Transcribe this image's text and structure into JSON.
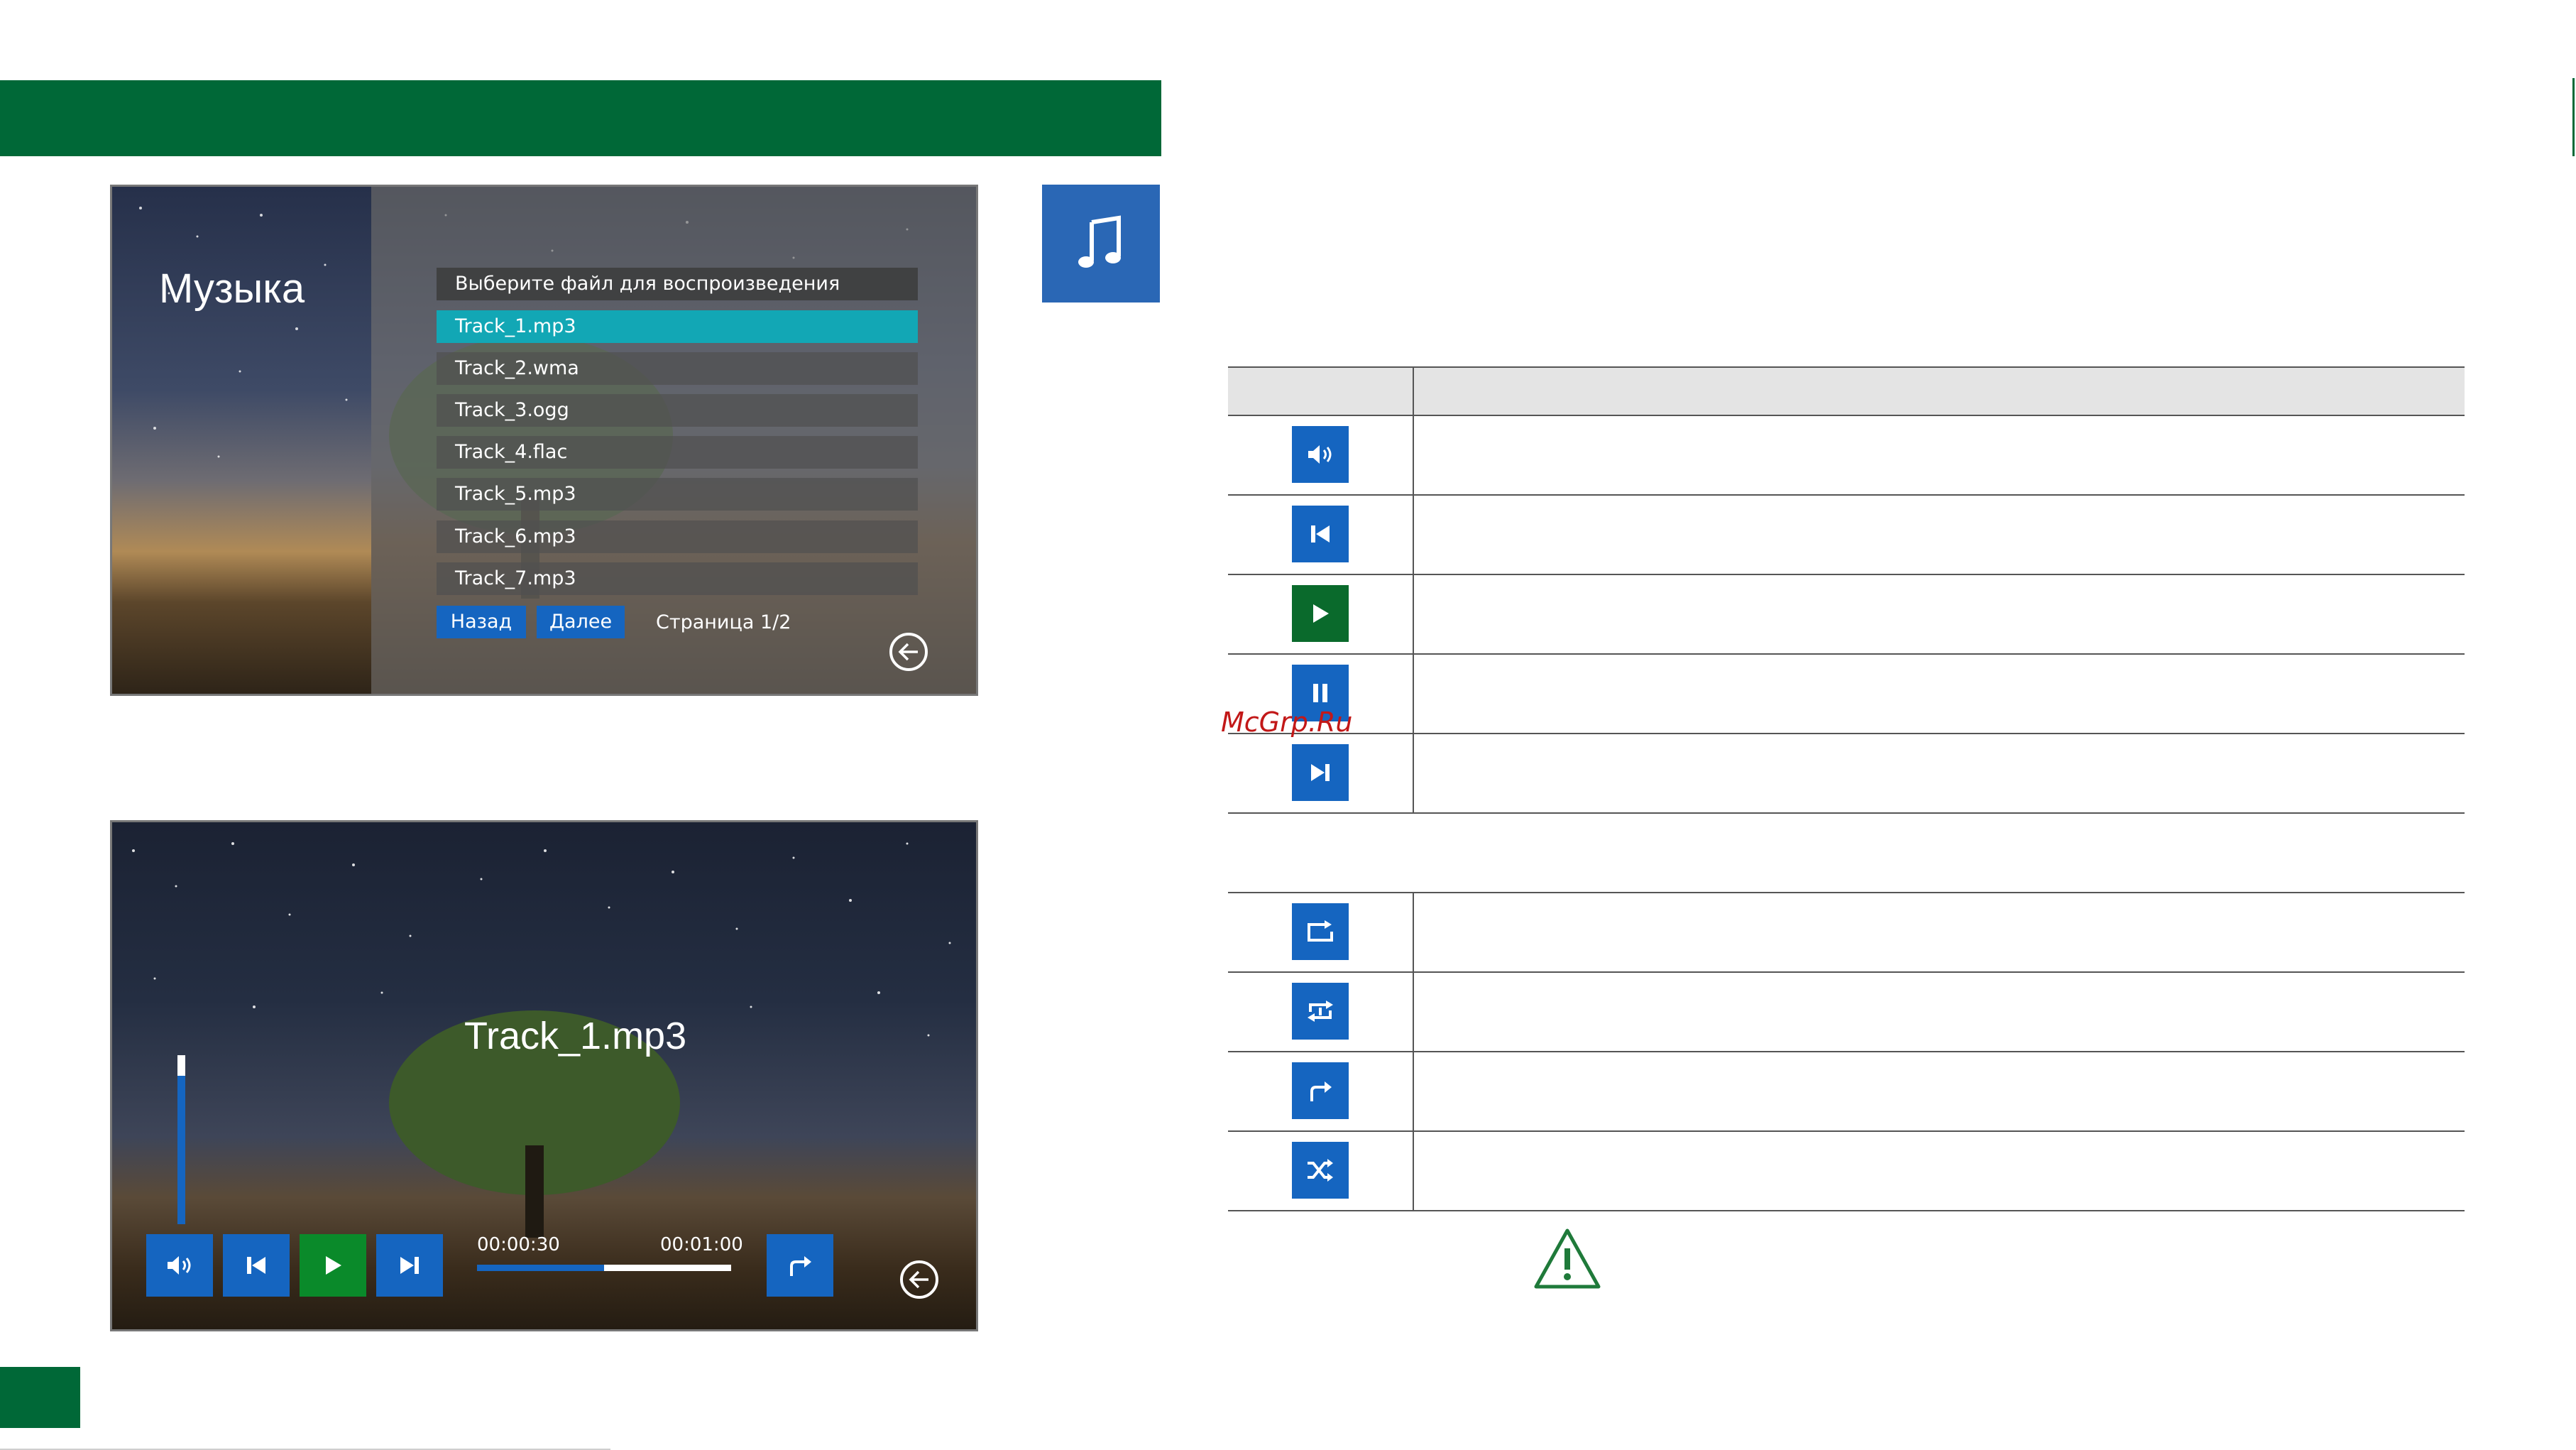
{
  "screen_list": {
    "title": "Музыка",
    "list_header": "Выберите файл для воспроизведения",
    "files": [
      "Track_1.mp3",
      "Track_2.wma",
      "Track_3.ogg",
      "Track_4.flac",
      "Track_5.mp3",
      "Track_6.mp3",
      "Track_7.mp3"
    ],
    "selected_index": 0,
    "back_button": "Назад",
    "next_button": "Далее",
    "page_label": "Страница 1/2"
  },
  "screen_player": {
    "track_title": "Track_1.mp3",
    "time_current": "00:00:30",
    "time_total": "00:01:00",
    "progress_fraction": 0.5,
    "volume_fraction": 0.88
  },
  "table": {
    "icons": [
      "volume-icon",
      "previous-track-icon",
      "play-icon",
      "pause-icon",
      "next-track-icon",
      "repeat-all-icon",
      "repeat-one-icon",
      "play-next-icon",
      "shuffle-icon"
    ]
  },
  "watermark": "McGrp.Ru",
  "colors": {
    "brand_green": "#006837",
    "button_blue": "#1565c0",
    "play_green": "#0a8a2a",
    "selected_row": "#12a7b5",
    "music_badge": "#2a67b5"
  }
}
